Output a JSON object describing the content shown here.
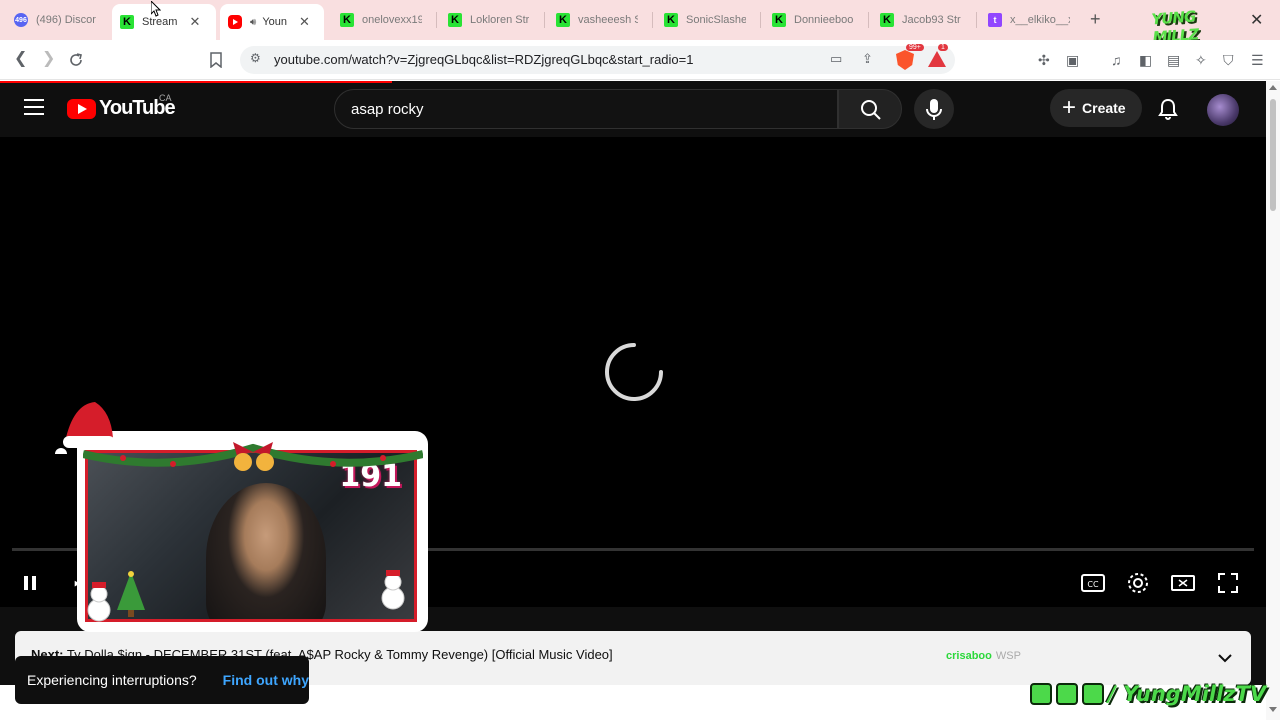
{
  "browser": {
    "tabs": [
      {
        "label": "(496) Discor",
        "icon": "discord-icon",
        "badge": "496"
      },
      {
        "label": "Stream",
        "icon": "kick-icon",
        "active": true
      },
      {
        "label": "Youn",
        "icon": "youtube-icon",
        "audio": true
      },
      {
        "label": "onelovexx19",
        "icon": "kick-icon"
      },
      {
        "label": "Lokloren Str",
        "icon": "kick-icon"
      },
      {
        "label": "vasheeesh S",
        "icon": "kick-icon"
      },
      {
        "label": "SonicSlashe",
        "icon": "kick-icon"
      },
      {
        "label": "Donnieeboo",
        "icon": "kick-icon"
      },
      {
        "label": "Jacob93 Str",
        "icon": "kick-icon"
      },
      {
        "label": "x__elkiko__x",
        "icon": "twitch-icon"
      }
    ],
    "new_tab_label": "+",
    "close_label": "✕",
    "url": "youtube.com/watch?v=ZjgreqGLbqc&list=RDZjgreqGLbqc&start_radio=1",
    "brave_badge": "99+",
    "alert_badge": "1",
    "corner_logo_text": "YUNG MILLZ"
  },
  "youtube": {
    "logo_text": "YouTube",
    "region": "CA",
    "search_value": "asap rocky",
    "create_label": "Create",
    "up_next": {
      "prefix": "Next:",
      "title": "Ty Dolla $ign - DECEMBER 31ST (feat. A$AP Rocky & Tommy Revenge) [Official Music Video]"
    },
    "toast": {
      "message": "Experiencing interruptions?",
      "action": "Find out why"
    }
  },
  "overlay": {
    "counter": "191",
    "kick_watermark": "crisaboo",
    "kick_watermark_suffix": "WSP",
    "socials_handle": "/ YungMillzTV"
  },
  "colors": {
    "youtube_red": "#ff0000",
    "kick_green": "#29e335",
    "tab_strip": "#f9dfe0",
    "link_blue": "#3ea6ff"
  }
}
